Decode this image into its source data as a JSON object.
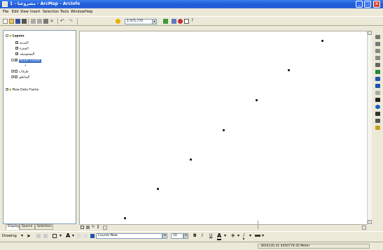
{
  "window": {
    "title": "1 - مشروعنا - ArcMap - ArcInfo",
    "minimize": "_",
    "maximize": "□",
    "close": "×"
  },
  "menu": [
    "File",
    "Edit",
    "View",
    "Insert",
    "Selection",
    "Tools",
    "Window",
    "Help"
  ],
  "toolbar": {
    "scale": "1:475,770"
  },
  "toc": {
    "root": "Layers",
    "layers": [
      "المدينة",
      "المتنزه",
      "المستوصف"
    ],
    "selected_layer": "Route Events",
    "sublayers": [
      "طرقات",
      "المناطق"
    ],
    "data_frame": "New Data Frame",
    "tabs": [
      "Display",
      "Source",
      "Selection"
    ]
  },
  "drawing": {
    "label": "Drawing",
    "font": "Courier New",
    "size": "10",
    "bold": "B",
    "italic": "I",
    "underline": "U"
  },
  "status": {
    "coords": "3654135.31  4450779.35 Meter"
  },
  "colors": {
    "title_blue": "#245edb",
    "selection": "#316ac5",
    "chrome": "#ece9d8"
  }
}
